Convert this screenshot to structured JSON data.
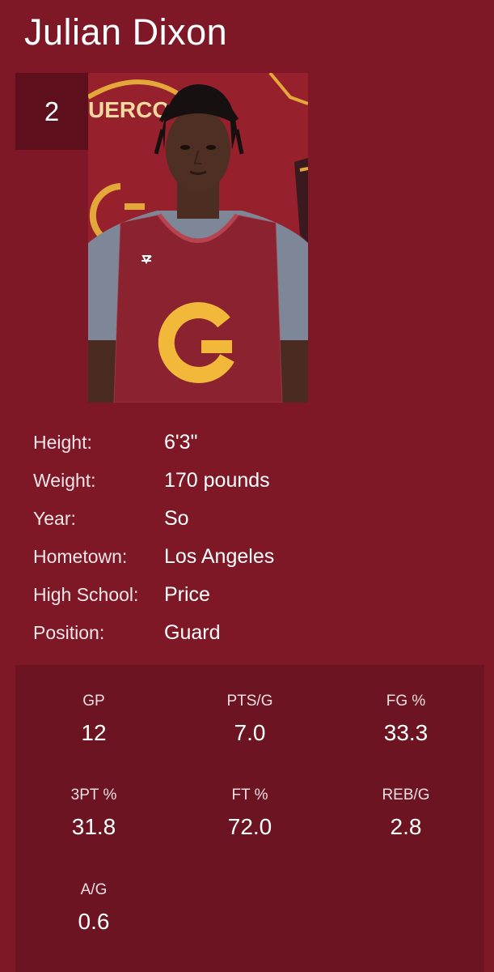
{
  "player": {
    "name": "Julian Dixon",
    "number": "2"
  },
  "photo": {
    "alt": "Julian Dixon headshot",
    "background_letters": "UERCO"
  },
  "info": [
    {
      "label": "Height:",
      "value": "6'3\""
    },
    {
      "label": "Weight:",
      "value": "170 pounds"
    },
    {
      "label": "Year:",
      "value": "So"
    },
    {
      "label": "Hometown:",
      "value": "Los Angeles"
    },
    {
      "label": "High School:",
      "value": "Price"
    },
    {
      "label": "Position:",
      "value": "Guard"
    }
  ],
  "stats": [
    {
      "label": "GP",
      "value": "12"
    },
    {
      "label": "PTS/G",
      "value": "7.0"
    },
    {
      "label": "FG %",
      "value": "33.3"
    },
    {
      "label": "3PT %",
      "value": "31.8"
    },
    {
      "label": "FT %",
      "value": "72.0"
    },
    {
      "label": "REB/G",
      "value": "2.8"
    },
    {
      "label": "A/G",
      "value": "0.6"
    }
  ],
  "colors": {
    "background": "#7e1726",
    "badge": "#5e0f1c",
    "stats_panel": "#6c1421",
    "gold": "#f2b83a",
    "jersey": "#8a2230"
  }
}
